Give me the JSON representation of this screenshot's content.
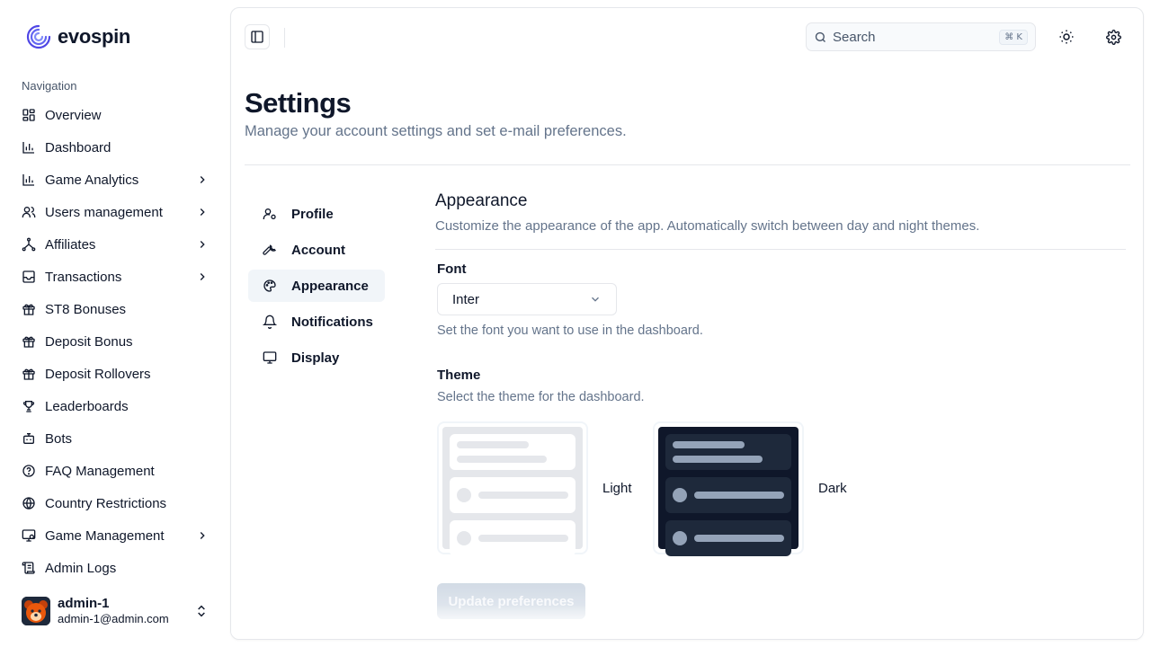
{
  "brand": {
    "name": "evospin",
    "logo_icon": "spiral-logo-icon"
  },
  "sidebar": {
    "heading": "Navigation",
    "items": [
      {
        "label": "Overview",
        "icon": "grid-icon",
        "expandable": false
      },
      {
        "label": "Dashboard",
        "icon": "bar-chart-icon",
        "expandable": false
      },
      {
        "label": "Game Analytics",
        "icon": "bar-chart-icon",
        "expandable": true
      },
      {
        "label": "Users management",
        "icon": "users-icon",
        "expandable": true
      },
      {
        "label": "Affiliates",
        "icon": "network-icon",
        "expandable": true
      },
      {
        "label": "Transactions",
        "icon": "inbox-icon",
        "expandable": true
      },
      {
        "label": "ST8 Bonuses",
        "icon": "gift-icon",
        "expandable": false
      },
      {
        "label": "Deposit Bonus",
        "icon": "gift-icon",
        "expandable": false
      },
      {
        "label": "Deposit Rollovers",
        "icon": "gift-icon",
        "expandable": false
      },
      {
        "label": "Leaderboards",
        "icon": "trophy-icon",
        "expandable": false
      },
      {
        "label": "Bots",
        "icon": "bot-icon",
        "expandable": false
      },
      {
        "label": "FAQ Management",
        "icon": "help-circle-icon",
        "expandable": false
      },
      {
        "label": "Country Restrictions",
        "icon": "globe-icon",
        "expandable": false
      },
      {
        "label": "Game Management",
        "icon": "monitor-cog-icon",
        "expandable": true
      },
      {
        "label": "Admin Logs",
        "icon": "scroll-icon",
        "expandable": false
      }
    ],
    "user": {
      "name": "admin-1",
      "email": "admin-1@admin.com"
    }
  },
  "topbar": {
    "search_placeholder": "Search",
    "shortcut": "⌘ K"
  },
  "page": {
    "title": "Settings",
    "subtitle": "Manage your account settings and set e-mail preferences."
  },
  "subnav": [
    {
      "label": "Profile",
      "icon": "user-cog-icon",
      "active": false
    },
    {
      "label": "Account",
      "icon": "wrench-icon",
      "active": false
    },
    {
      "label": "Appearance",
      "icon": "palette-icon",
      "active": true
    },
    {
      "label": "Notifications",
      "icon": "bell-icon",
      "active": false
    },
    {
      "label": "Display",
      "icon": "monitor-icon",
      "active": false
    }
  ],
  "appearance": {
    "title": "Appearance",
    "subtitle": "Customize the appearance of the app. Automatically switch between day and night themes.",
    "font_label": "Font",
    "font_value": "Inter",
    "font_help": "Set the font you want to use in the dashboard.",
    "theme_label": "Theme",
    "theme_help": "Select the theme for the dashboard.",
    "themes": [
      {
        "label": "Light"
      },
      {
        "label": "Dark"
      }
    ],
    "submit_label": "Update preferences"
  }
}
